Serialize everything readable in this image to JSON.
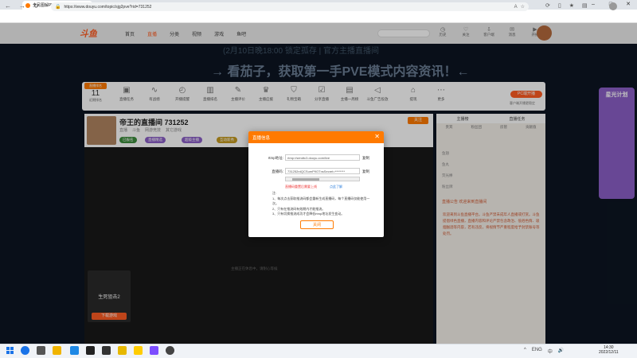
{
  "browser": {
    "tab_title": "全民图解PVE",
    "url": "https://www.douyu.com/topic/sjg2pve?rid=731252"
  },
  "header": {
    "logo": "斗鱼",
    "nav": [
      "首页",
      "直播",
      "分类",
      "视频",
      "游戏",
      "鱼吧"
    ],
    "nav_active_index": 1,
    "search_placeholder": "",
    "icons": [
      {
        "icon": "history-icon",
        "label": "历史"
      },
      {
        "icon": "follow-icon",
        "label": "关注"
      },
      {
        "icon": "download-icon",
        "label": "客户端"
      },
      {
        "icon": "message-icon",
        "label": "消息"
      },
      {
        "icon": "broadcast-icon",
        "label": "开播"
      }
    ]
  },
  "banner": {
    "line1": "(2月10日晚18:00        锁定孤存 | 官方主播直播间",
    "line2": "→ 看茄子，获取第一手PVE模式内容资讯！←"
  },
  "toolbar": {
    "rank_tag": "直播排名",
    "rank_num": "11",
    "rank_label": "近期排名",
    "tools": [
      "直播任务",
      "有战绩",
      "开播提醒",
      "直播排名",
      "主播评价",
      "主播应援",
      "礼物宝箱",
      "分享直播",
      "主播一周榜",
      "斗鱼广告投放",
      "提现",
      "更多"
    ],
    "pc_button": "PC端开播",
    "pc_sub": "客户端开播更稳定"
  },
  "stream": {
    "room_title": "帝王的直播间 731252",
    "meta": [
      "直播",
      "斗鱼",
      "网游竞技",
      "其它游戏"
    ],
    "tags": [
      "已报名",
      "直播精选",
      "超级主播",
      "互动新秀"
    ],
    "follow": "关注",
    "empty_text": "主播正在休息中，请耐心等候",
    "game_name": "生死狙击2",
    "game_button": "下载游戏"
  },
  "right_panel": {
    "tabs": [
      "主播榜",
      "直播任务"
    ],
    "subtabs": [
      "贵宾",
      "粉丝团",
      "房管",
      "贡献值"
    ],
    "list": [
      "鱼翅",
      "鱼丸",
      "荧光棒",
      "粉丝牌",
      "超管"
    ],
    "chat_head": "直播公告 欢迎来到直播间",
    "chat_msg": "欢迎来到斗鱼直播平台。斗鱼严禁未成年人直播或打赏。斗鱼提倡绿色直播，直播内容和评论严禁包含政治、低俗色情、吸烟酗酒等内容，若有违反，将视情节严重程度给予封禁账号等处罚。"
  },
  "side_promo": {
    "title": "星光计划"
  },
  "dialog": {
    "title": "直播信息",
    "rtmp_label": "rtmp地址:",
    "rtmp_value": "rtmp://sendtc3.douyu.com/live",
    "stream_label": "直播码:",
    "stream_value": "731252rdQCSumP9OTnsSecret=********",
    "copy": "复制",
    "warn": "直播码重置后需要上线",
    "warn_link": "点此了解",
    "note_title": "注:",
    "note_lines": [
      "1、每次点击获取推流码都会重新生成直播码，每个直播码仅能使用一次。",
      "2、只有在推流码有效期内才能推流。",
      "3、只有切换推流成功才会降低rtmp地址发生变动。"
    ],
    "ok": "关闭"
  },
  "taskbar": {
    "time": "14:30",
    "date": "2022/12/11",
    "tray": [
      "^",
      "ENG",
      "中",
      "🔊"
    ]
  },
  "colors": {
    "accent": "#ff7a00",
    "brand": "#ff5d23",
    "stage_bg": "#0c1522"
  }
}
